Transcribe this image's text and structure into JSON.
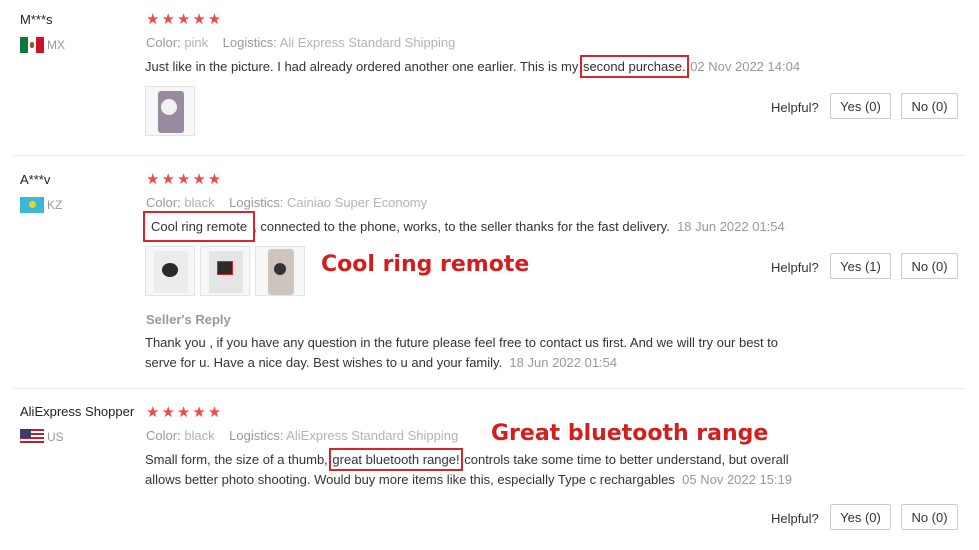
{
  "reviews": [
    {
      "user": "M***s",
      "country": "MX",
      "stars": "★★★★★",
      "color_label": "Color:",
      "color_value": "pink",
      "logistics_label": "Logistics:",
      "logistics_value": "Ali Express Standard Shipping",
      "text_before": "Just like in the picture. I had already ordered another one earlier. This is my ",
      "text_highlight": "second purchase.",
      "text_after": "",
      "date": "02 Nov 2022 14:04",
      "helpful_label": "Helpful?",
      "yes_label": "Yes (0)",
      "no_label": "No (0)"
    },
    {
      "user": "A***v",
      "country": "KZ",
      "stars": "★★★★★",
      "color_label": "Color:",
      "color_value": "black",
      "logistics_label": "Logistics:",
      "logistics_value": "Cainiao Super Economy",
      "text_highlight": "Cool ring remote",
      "text_after": ", connected to the phone, works, to the seller thanks for the fast delivery.",
      "date": "18 Jun 2022 01:54",
      "helpful_label": "Helpful?",
      "yes_label": "Yes (1)",
      "no_label": "No (0)",
      "seller_reply_title": "Seller's Reply",
      "seller_reply_line1": "Thank you , if you have any question in the future please feel free to contact us first. And we will try our best to",
      "seller_reply_line2": "serve for u. Have a nice day. Best wishes to u and your family.",
      "seller_reply_date": "18 Jun 2022 01:54"
    },
    {
      "user": "AliExpress Shopper",
      "country": "US",
      "stars": "★★★★★",
      "color_label": "Color:",
      "color_value": "black",
      "logistics_label": "Logistics:",
      "logistics_value": "AliExpress Standard Shipping",
      "text_before": "Small form, the size of a thumb, ",
      "text_highlight": "great bluetooth range!",
      "text_after": " controls take some time to better understand, but overall",
      "text_line2": "allows better photo shooting. Would buy more items like this, especially Type c rechargables",
      "date": "05 Nov 2022 15:19",
      "helpful_label": "Helpful?",
      "yes_label": "Yes (0)",
      "no_label": "No (0)"
    }
  ],
  "annotations": {
    "cool_ring": "Cool ring remote",
    "bluetooth": "Great bluetooth range"
  },
  "colors": {
    "star": "#f04b4b",
    "highlight": "#d4262b",
    "annotation": "#d41e1e"
  }
}
